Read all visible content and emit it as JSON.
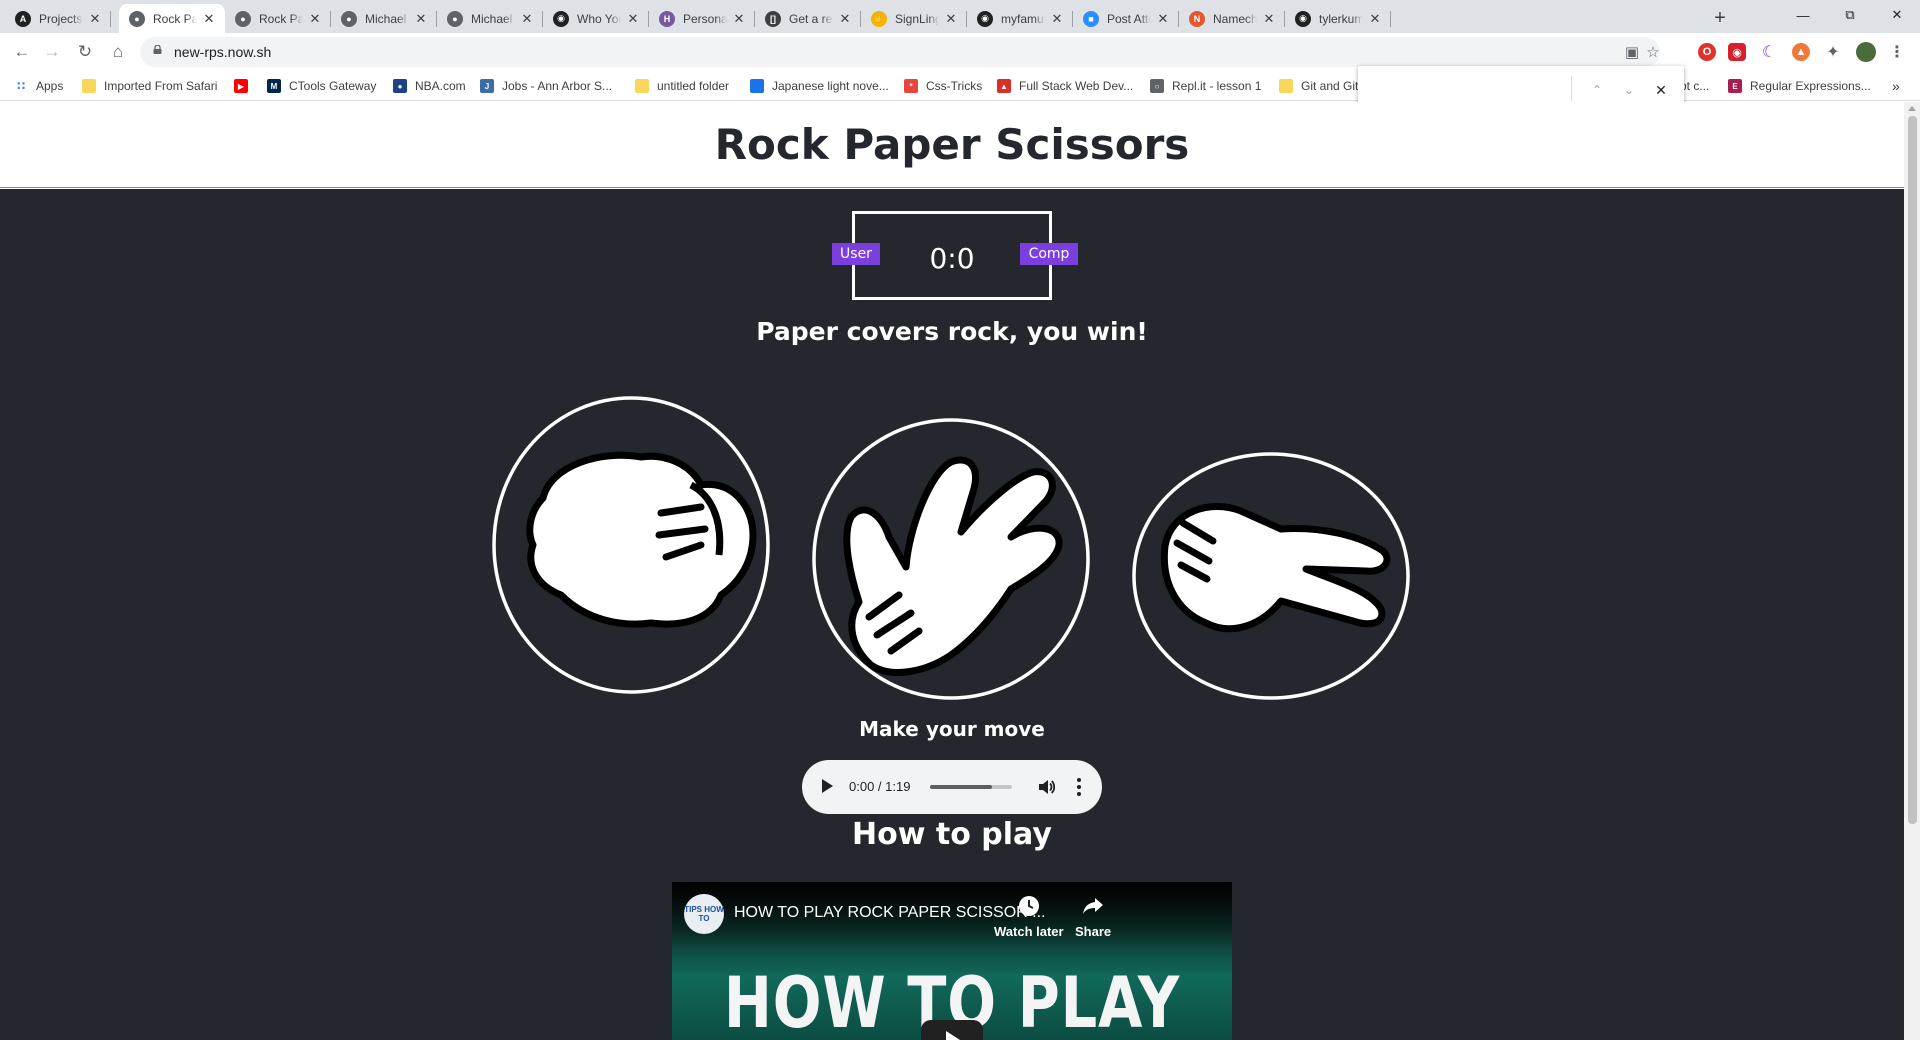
{
  "browser": {
    "tabs": [
      {
        "title": "Projects - Dashboard",
        "icon": "circle-a-icon",
        "color": "#202124",
        "active": false
      },
      {
        "title": "Rock Paper Scissors",
        "icon": "globe-icon",
        "color": "#5f6368",
        "active": true
      },
      {
        "title": "Rock Paper Scissors",
        "icon": "globe-icon",
        "color": "#5f6368",
        "active": false
      },
      {
        "title": "Michael Famurewa",
        "icon": "globe-icon",
        "color": "#5f6368",
        "active": false
      },
      {
        "title": "Michael Famurewa",
        "icon": "globe-icon",
        "color": "#5f6368",
        "active": false
      },
      {
        "title": "Who You're Following",
        "icon": "github-icon",
        "color": "#202124",
        "active": false
      },
      {
        "title": "Personal apps",
        "icon": "heroku-icon",
        "color": "#79589f",
        "active": false
      },
      {
        "title": "Get a refresher",
        "icon": "bracket-icon",
        "color": "#3c4043",
        "active": false
      },
      {
        "title": "SignLingo",
        "icon": "hand-icon",
        "color": "#f4b400",
        "active": false
      },
      {
        "title": "myfamurewa",
        "icon": "github-icon",
        "color": "#202124",
        "active": false
      },
      {
        "title": "Post Attendee",
        "icon": "zoom-icon",
        "color": "#2d8cff",
        "active": false
      },
      {
        "title": "Namecheap",
        "icon": "namecheap-icon",
        "color": "#e4572e",
        "active": false
      },
      {
        "title": "tylerkummer",
        "icon": "github-icon",
        "color": "#202124",
        "active": false
      }
    ],
    "url": "new-rps.now.sh",
    "bookmarks": [
      {
        "label": "Apps",
        "icon": "apps-grid-icon"
      },
      {
        "label": "Imported From Safari",
        "icon": "folder-icon"
      },
      {
        "label": "",
        "icon": "youtube-icon"
      },
      {
        "label": "CTools Gateway",
        "icon": "michigan-m-icon"
      },
      {
        "label": "NBA.com",
        "icon": "nba-icon"
      },
      {
        "label": "Jobs - Ann Arbor S...",
        "icon": "jobs-icon"
      },
      {
        "label": "untitled folder",
        "icon": "folder-icon"
      },
      {
        "label": "Japanese light nove...",
        "icon": "blue-square-icon"
      },
      {
        "label": "Css-Tricks",
        "icon": "css-tricks-icon"
      },
      {
        "label": "Full Stack Web Dev...",
        "icon": "shield-icon"
      },
      {
        "label": "Repl.it - lesson 1",
        "icon": "replit-icon"
      },
      {
        "label": "Git and Git",
        "icon": "folder-icon"
      },
      {
        "label": "ot c...",
        "icon": ""
      },
      {
        "label": "Regular Expressions...",
        "icon": "ejs-icon"
      }
    ],
    "find_value": "",
    "colors": {
      "accent": "#7b3fe0",
      "game_bg": "#24272e"
    }
  },
  "page": {
    "title": "Rock Paper Scissors",
    "user_label": "User",
    "comp_label": "Comp",
    "score": "0:0",
    "result": "Paper covers rock, you win!",
    "choices": [
      "rock-icon",
      "paper-icon",
      "scissors-icon"
    ],
    "prompt": "Make your move",
    "audio": {
      "time": "0:00 / 1:19",
      "volume_level": 0.75
    },
    "how_to_heading": "How to play",
    "video": {
      "title": "HOW TO PLAY ROCK PAPER SCISSOR ...",
      "channel_badge": "TIPS HOW TO",
      "watch_later": "Watch later",
      "share": "Share",
      "thumbnail_text": "HOW TO PLAY"
    }
  }
}
